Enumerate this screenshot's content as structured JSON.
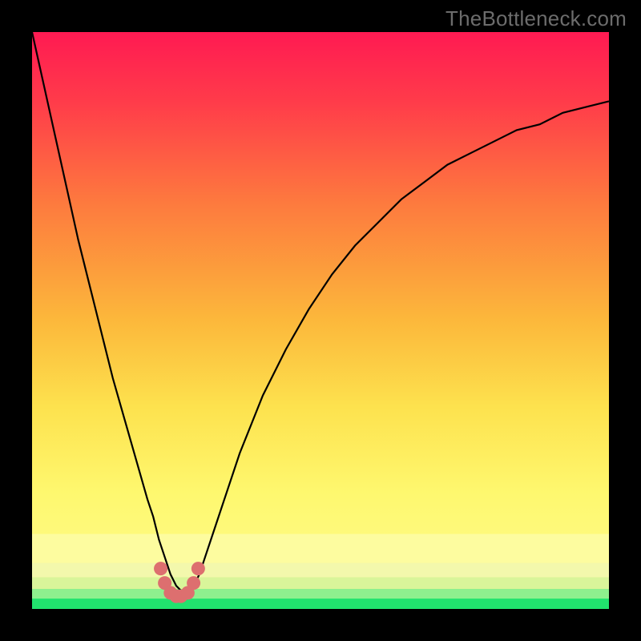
{
  "watermark": "TheBottleneck.com",
  "chart_data": {
    "type": "line",
    "title": "",
    "xlabel": "",
    "ylabel": "",
    "xlim": [
      0,
      100
    ],
    "ylim": [
      0,
      100
    ],
    "grid": false,
    "series": [
      {
        "name": "curve",
        "color": "#000000",
        "x": [
          0,
          2,
          4,
          6,
          8,
          10,
          12,
          14,
          16,
          18,
          20,
          21,
          22,
          23,
          24,
          25,
          26,
          27,
          28,
          29,
          30,
          32,
          34,
          36,
          38,
          40,
          44,
          48,
          52,
          56,
          60,
          64,
          68,
          72,
          76,
          80,
          84,
          88,
          92,
          96,
          100
        ],
        "y": [
          100,
          91,
          82,
          73,
          64,
          56,
          48,
          40,
          33,
          26,
          19,
          16,
          12,
          9,
          6,
          4,
          3,
          3,
          4,
          6,
          9,
          15,
          21,
          27,
          32,
          37,
          45,
          52,
          58,
          63,
          67,
          71,
          74,
          77,
          79,
          81,
          83,
          84,
          86,
          87,
          88
        ]
      },
      {
        "name": "marker-dots",
        "color": "#dd6f6f",
        "x": [
          22.3,
          23.0,
          24.0,
          25.0,
          25.8,
          27.0,
          28.0,
          28.8
        ],
        "y": [
          7.0,
          4.5,
          2.8,
          2.2,
          2.2,
          2.8,
          4.5,
          7.0
        ]
      }
    ],
    "bands": [
      {
        "name": "green-band",
        "y0": 0.0,
        "y1": 1.8,
        "color": "#21e36e"
      },
      {
        "name": "light-green-band",
        "y0": 1.8,
        "y1": 3.5,
        "color": "#8ef08e"
      },
      {
        "name": "pale-band-1",
        "y0": 3.5,
        "y1": 5.5,
        "color": "#d9f59a"
      },
      {
        "name": "pale-band-2",
        "y0": 5.5,
        "y1": 8.0,
        "color": "#f3f8ac"
      },
      {
        "name": "yellow-band",
        "y0": 8.0,
        "y1": 13.0,
        "color": "#fdfc9f"
      }
    ],
    "gradient_stops": [
      {
        "offset": 0,
        "color": "#ff1a52"
      },
      {
        "offset": 12,
        "color": "#ff3b4a"
      },
      {
        "offset": 30,
        "color": "#fd7b3e"
      },
      {
        "offset": 50,
        "color": "#fcb83b"
      },
      {
        "offset": 65,
        "color": "#fde24e"
      },
      {
        "offset": 80,
        "color": "#fef86f"
      },
      {
        "offset": 100,
        "color": "#fefc90"
      }
    ]
  }
}
